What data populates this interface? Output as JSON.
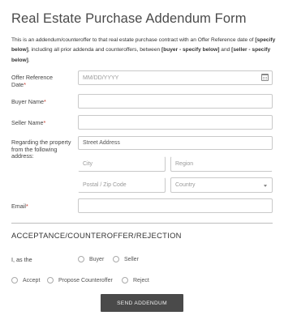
{
  "form": {
    "title": "Real Estate Purchase Addendum Form",
    "intro_1": "This is an addendum/counteroffer to that real estate purchase contract with an Offer Reference date of ",
    "intro_b1": "[specify below]",
    "intro_2": ", including all prior addenda and counteroffers, between ",
    "intro_b2": "[buyer -  specify below]",
    "intro_3": " and ",
    "intro_b3": "[seller - specify below]",
    "intro_4": "."
  },
  "fields": {
    "offer_date_label": "Offer Reference Date",
    "offer_date_placeholder": "MM/DD/YYYY",
    "buyer_label": "Buyer Name",
    "seller_label": "Seller Name",
    "property_label": "Regarding the property from the following address:",
    "street": "Street Address",
    "city": "City",
    "region": "Region",
    "postal": "Postal / Zip Code",
    "country": "Country",
    "email_label": "Email",
    "required_mark": "*"
  },
  "acceptance": {
    "section_title": "ACCEPTANCE/COUNTEROFFER/REJECTION",
    "i_as_the": "I, as the",
    "buyer": "Buyer",
    "seller": "Seller",
    "accept": "Accept",
    "propose": "Propose Counteroffer",
    "reject": "Reject"
  },
  "submit_label": "SEND ADDENDUM"
}
